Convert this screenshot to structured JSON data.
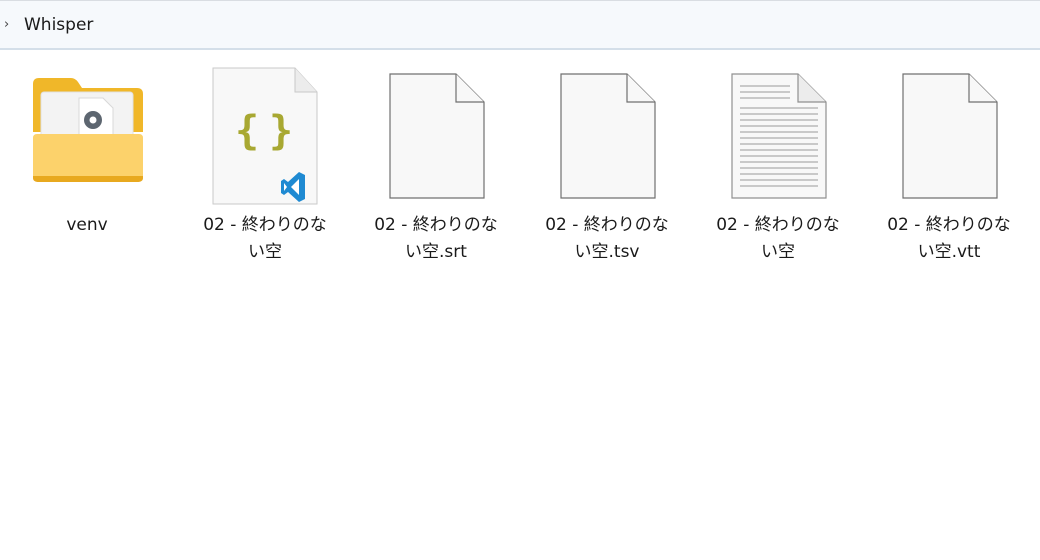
{
  "breadcrumb": {
    "chevron": "›",
    "folder": "Whisper"
  },
  "files": [
    {
      "name": "venv",
      "icon": "folder-icon"
    },
    {
      "name": "02 - 終わりのない空",
      "icon": "vscode-json-file-icon"
    },
    {
      "name": "02 - 終わりのない空.srt",
      "icon": "blank-file-icon"
    },
    {
      "name": "02 - 終わりのない空.tsv",
      "icon": "blank-file-icon"
    },
    {
      "name": "02 - 終わりのない空",
      "icon": "text-file-icon"
    },
    {
      "name": "02 - 終わりのない空.vtt",
      "icon": "blank-file-icon"
    }
  ],
  "colors": {
    "folder_back": "#f0b729",
    "folder_front": "#fcd26b",
    "json_braces": "#a8a832",
    "vscode_blue": "#1f8ad2"
  }
}
